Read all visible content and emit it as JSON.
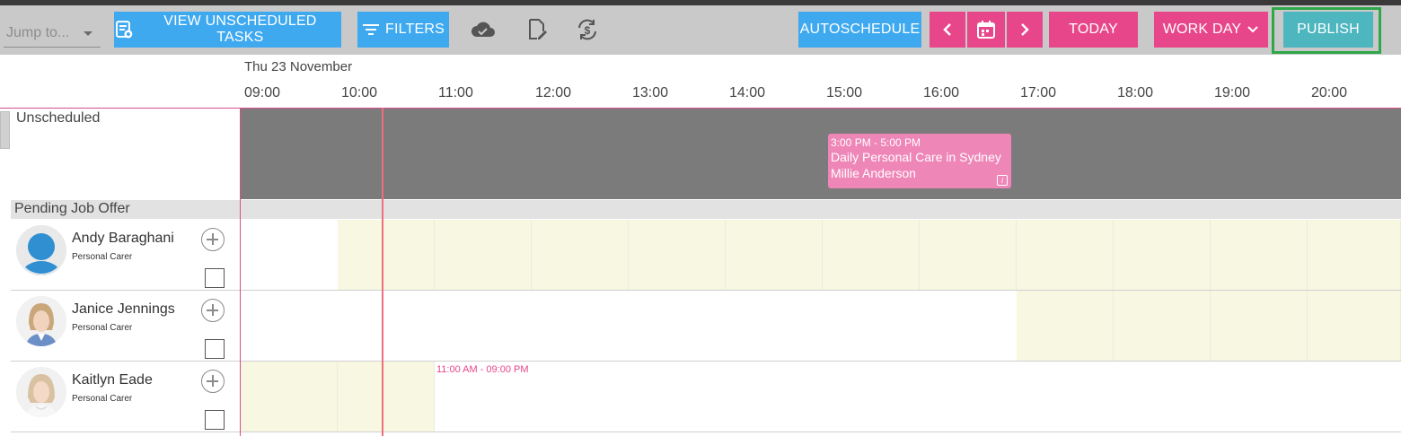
{
  "toolbar": {
    "jump_placeholder": "Jump to...",
    "view_unscheduled": "VIEW UNSCHEDULED TASKS",
    "filters": "FILTERS",
    "autoschedule": "AUTOSCHEDULE",
    "today": "TODAY",
    "work_day": "WORK DAY",
    "publish": "PUBLISH"
  },
  "calendar": {
    "date": "Thu 23 November",
    "hours": [
      "09:00",
      "10:00",
      "11:00",
      "12:00",
      "13:00",
      "14:00",
      "15:00",
      "16:00",
      "17:00",
      "18:00",
      "19:00",
      "20:00"
    ]
  },
  "unscheduled": {
    "label": "Unscheduled",
    "task": {
      "time": "3:00 PM - 5:00 PM",
      "title": "Daily Personal Care in Sydney",
      "client": "Millie Anderson",
      "info_icon": "i"
    }
  },
  "pending": {
    "label": "Pending Job Offer"
  },
  "staff": [
    {
      "name": "Andy Baraghani",
      "role": "Personal Carer",
      "avatar": "default-user-icon"
    },
    {
      "name": "Janice Jennings",
      "role": "Personal Carer",
      "avatar": "photo"
    },
    {
      "name": "Kaitlyn Eade",
      "role": "Personal Carer",
      "avatar": "photo",
      "shift": "11:00 AM - 09:00 PM"
    }
  ],
  "colors": {
    "blue": "#3fa9f0",
    "pink": "#e8468a",
    "teal": "#4db6bf",
    "highlight": "#2fa84a",
    "unscheduled_bg": "#7b7b7b",
    "task_bg": "#ef86b8",
    "available": "#f7f7e2"
  }
}
